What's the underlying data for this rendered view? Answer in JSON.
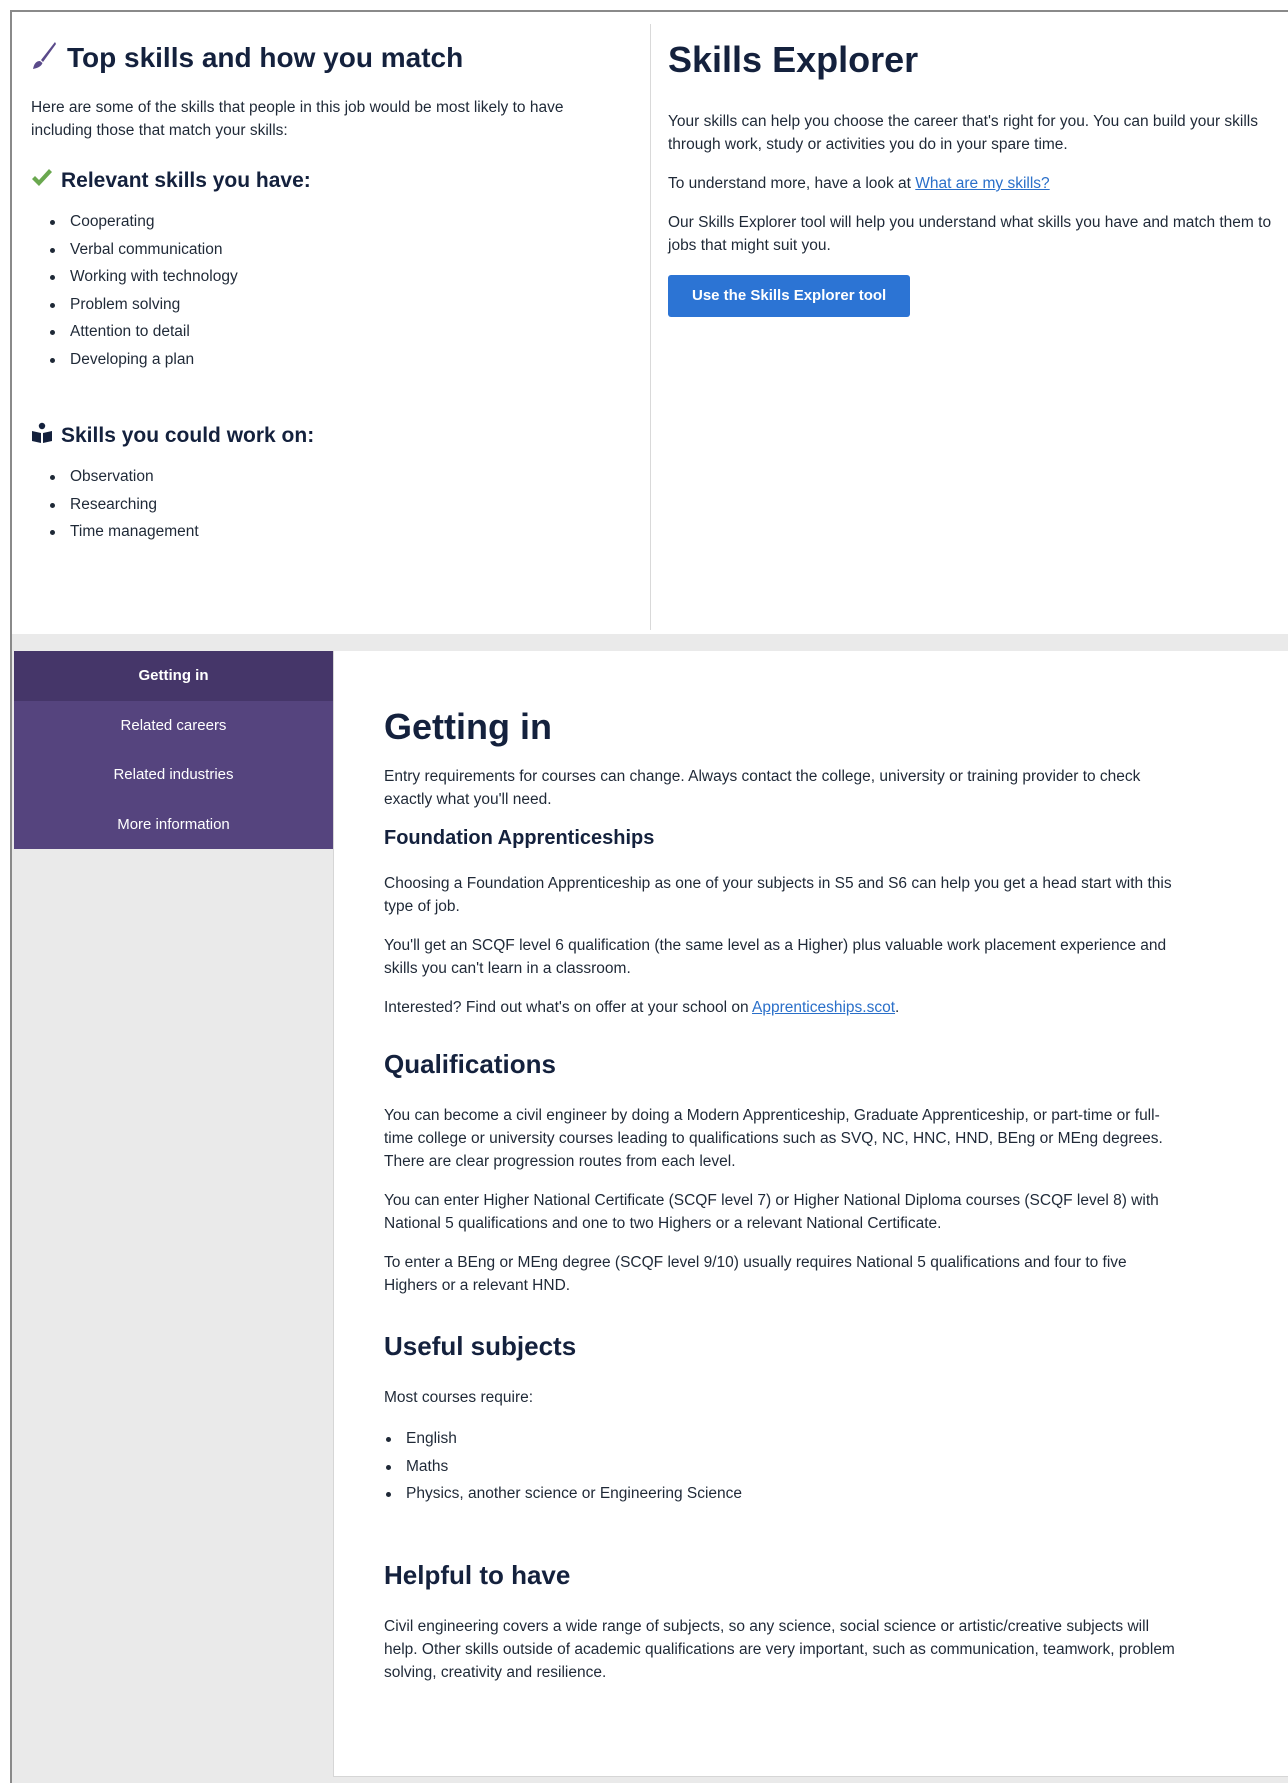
{
  "top_skills": {
    "title": "Top skills and how you match",
    "intro": "Here are some of the skills that people in this job would be most likely to have including those that match your skills:",
    "relevant_heading": "Relevant skills you have:",
    "relevant_skills": [
      "Cooperating",
      "Verbal communication",
      "Working with technology",
      "Problem solving",
      "Attention to detail",
      "Developing a plan"
    ],
    "work_on_heading": "Skills you could work on:",
    "work_on_skills": [
      "Observation",
      "Researching",
      "Time management"
    ]
  },
  "skills_explorer": {
    "title": "Skills Explorer",
    "para1": "Your skills can help you choose the career that's right for you. You can build your skills through work, study or activities you do in your spare time.",
    "para2_prefix": "To understand more, have a look at ",
    "para2_link": "What are my skills?",
    "para3": "Our Skills Explorer tool will help you understand what skills you have and match them to jobs that might suit you.",
    "button_label": "Use the Skills Explorer tool"
  },
  "sidenav": {
    "items": [
      {
        "label": "Getting in",
        "active": true
      },
      {
        "label": "Related careers",
        "active": false
      },
      {
        "label": "Related industries",
        "active": false
      },
      {
        "label": "More information",
        "active": false
      }
    ]
  },
  "main": {
    "title": "Getting in",
    "intro": "Entry requirements for courses can change. Always contact the college, university or training provider to check exactly what you'll need.",
    "foundation": {
      "heading": "Foundation Apprenticeships",
      "p1": "Choosing a Foundation Apprenticeship as one of your subjects in S5 and S6 can help you get a head start with this type of job.",
      "p2": "You'll get an SCQF level 6 qualification (the same level as a Higher) plus valuable work placement experience and skills you can't learn in a classroom.",
      "p3_prefix": "Interested? Find out what's on offer at your school on ",
      "p3_link": "Apprenticeships.scot",
      "p3_suffix": "."
    },
    "qualifications": {
      "heading": "Qualifications",
      "p1": "You can become a civil engineer by doing a Modern Apprenticeship, Graduate Apprenticeship, or part-time or full-time college or university courses leading to qualifications such as SVQ, NC, HNC, HND, BEng or MEng degrees. There are clear progression routes from each level.",
      "p2": "You can enter Higher National Certificate (SCQF level 7) or Higher National Diploma courses (SCQF level 8) with National 5 qualifications and one to two Highers or a relevant National Certificate.",
      "p3": "To enter a BEng or MEng degree (SCQF level 9/10) usually requires National 5 qualifications and four to five Highers or a relevant HND."
    },
    "useful_subjects": {
      "heading": "Useful subjects",
      "intro": "Most courses require:",
      "items": [
        "English",
        "Maths",
        "Physics, another science or Engineering Science"
      ]
    },
    "helpful": {
      "heading": "Helpful to have",
      "p1": "Civil engineering covers a wide range of subjects, so any science, social science or artistic/creative subjects will help. Other skills outside of academic qualifications are very important, such as communication, teamwork, problem solving, creativity and resilience."
    }
  },
  "colors": {
    "heading": "#14213d",
    "nav_bg": "#55447e",
    "nav_active": "#453669",
    "button": "#2c74d4",
    "link": "#2a6fc9",
    "check": "#6aa84f",
    "brush": "#5a4a8a"
  },
  "icons": {
    "top_skills": "paintbrush-icon",
    "relevant": "checkmark-icon",
    "work_on": "reading-person-icon"
  }
}
